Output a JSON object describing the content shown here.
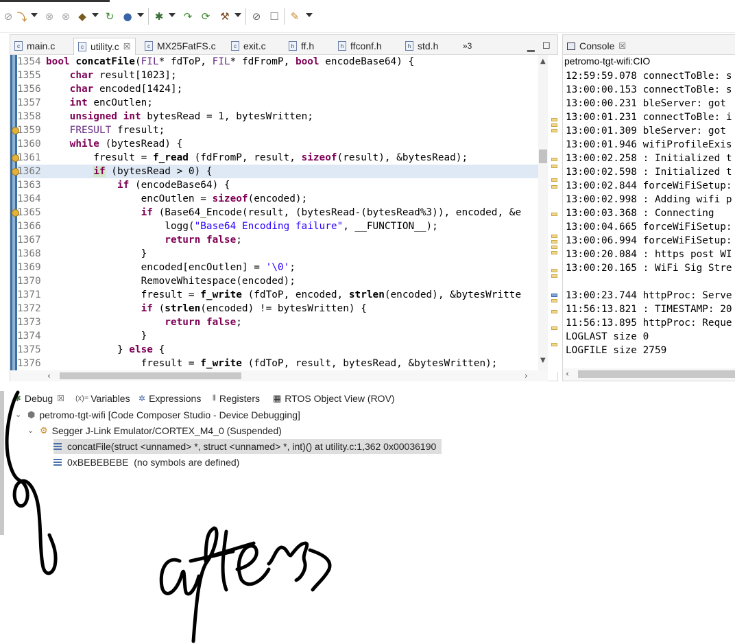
{
  "toolbar": {
    "buttons": [
      "resume-icon",
      "step-icon",
      "build-icon",
      "debug-icon",
      "run-icon",
      "external-tools-icon",
      "hammer-icon",
      "search-icon",
      "console-icon",
      "pin-icon"
    ]
  },
  "editor": {
    "tabs": [
      {
        "label": "main.c"
      },
      {
        "label": "utility.c",
        "active": true,
        "close": "☒"
      },
      {
        "label": "MX25FatFS.c"
      },
      {
        "label": "exit.c"
      },
      {
        "label": "ff.h"
      },
      {
        "label": "ffconf.h"
      },
      {
        "label": "std.h"
      }
    ],
    "overflow_label": "»3",
    "lines": [
      {
        "n": "1354",
        "segs": [
          [
            "kw",
            "bool"
          ],
          [
            "t",
            " "
          ],
          [
            "fn",
            "concatFile"
          ],
          [
            "t",
            "("
          ],
          [
            "ty",
            "FIL"
          ],
          [
            "t",
            "* fdToP, "
          ],
          [
            "ty",
            "FIL"
          ],
          [
            "t",
            "* fdFromP, "
          ],
          [
            "kw",
            "bool"
          ],
          [
            "t",
            " encodeBase64) {"
          ]
        ]
      },
      {
        "n": "1355",
        "segs": [
          [
            "t",
            "    "
          ],
          [
            "kw",
            "char"
          ],
          [
            "t",
            " result[1023];"
          ]
        ]
      },
      {
        "n": "1356",
        "segs": [
          [
            "t",
            "    "
          ],
          [
            "kw",
            "char"
          ],
          [
            "t",
            " encoded[1424];"
          ]
        ]
      },
      {
        "n": "1357",
        "segs": [
          [
            "t",
            "    "
          ],
          [
            "kw",
            "int"
          ],
          [
            "t",
            " encOutlen;"
          ]
        ]
      },
      {
        "n": "1358",
        "segs": [
          [
            "t",
            "    "
          ],
          [
            "kw",
            "unsigned"
          ],
          [
            "t",
            " "
          ],
          [
            "kw",
            "int"
          ],
          [
            "t",
            " bytesRead = 1, bytesWritten;"
          ]
        ]
      },
      {
        "n": "1359",
        "segs": [
          [
            "t",
            "    "
          ],
          [
            "ty",
            "FRESULT"
          ],
          [
            "t",
            " fresult;"
          ]
        ]
      },
      {
        "n": "1360",
        "segs": [
          [
            "t",
            "    "
          ],
          [
            "kw",
            "while"
          ],
          [
            "t",
            " (bytesRead) {"
          ]
        ]
      },
      {
        "n": "1361",
        "segs": [
          [
            "t",
            "        fresult = "
          ],
          [
            "fn",
            "f_read"
          ],
          [
            "t",
            " (fdFromP, result, "
          ],
          [
            "kw",
            "sizeof"
          ],
          [
            "t",
            "(result), &bytesRead);"
          ]
        ]
      },
      {
        "n": "1362",
        "segs": [
          [
            "t",
            "        "
          ],
          [
            "kw",
            "if"
          ],
          [
            "t",
            " (bytesRead > 0) {"
          ]
        ]
      },
      {
        "n": "1363",
        "segs": [
          [
            "t",
            "            "
          ],
          [
            "kw",
            "if"
          ],
          [
            "t",
            " (encodeBase64) {"
          ]
        ]
      },
      {
        "n": "1364",
        "segs": [
          [
            "t",
            "                encOutlen = "
          ],
          [
            "kw",
            "sizeof"
          ],
          [
            "t",
            "(encoded);"
          ]
        ]
      },
      {
        "n": "1365",
        "segs": [
          [
            "t",
            "                "
          ],
          [
            "kw",
            "if"
          ],
          [
            "t",
            " (Base64_Encode(result, (bytesRead-(bytesRead%3)), encoded, &e"
          ]
        ]
      },
      {
        "n": "1366",
        "segs": [
          [
            "t",
            "                    logg("
          ],
          [
            "str",
            "\"Base64 Encoding failure\""
          ],
          [
            "t",
            ", __FUNCTION__);"
          ]
        ]
      },
      {
        "n": "1367",
        "segs": [
          [
            "t",
            "                    "
          ],
          [
            "kw",
            "return"
          ],
          [
            "t",
            " "
          ],
          [
            "kw",
            "false"
          ],
          [
            "t",
            ";"
          ]
        ]
      },
      {
        "n": "1368",
        "segs": [
          [
            "t",
            "                }"
          ]
        ]
      },
      {
        "n": "1369",
        "segs": [
          [
            "t",
            "                encoded[encOutlen] = "
          ],
          [
            "str",
            "'\\0'"
          ],
          [
            "t",
            ";"
          ]
        ]
      },
      {
        "n": "1370",
        "segs": [
          [
            "t",
            "                RemoveWhitespace(encoded);"
          ]
        ]
      },
      {
        "n": "1371",
        "segs": [
          [
            "t",
            "                fresult = "
          ],
          [
            "fn",
            "f_write"
          ],
          [
            "t",
            " (fdToP, encoded, "
          ],
          [
            "fn",
            "strlen"
          ],
          [
            "t",
            "(encoded), &bytesWritte"
          ]
        ]
      },
      {
        "n": "1372",
        "segs": [
          [
            "t",
            "                "
          ],
          [
            "kw",
            "if"
          ],
          [
            "t",
            " ("
          ],
          [
            "fn",
            "strlen"
          ],
          [
            "t",
            "(encoded) != bytesWritten) {"
          ]
        ]
      },
      {
        "n": "1373",
        "segs": [
          [
            "t",
            "                    "
          ],
          [
            "kw",
            "return"
          ],
          [
            "t",
            " "
          ],
          [
            "kw",
            "false"
          ],
          [
            "t",
            ";"
          ]
        ]
      },
      {
        "n": "1374",
        "segs": [
          [
            "t",
            "                }"
          ]
        ]
      },
      {
        "n": "1375",
        "segs": [
          [
            "t",
            "            } "
          ],
          [
            "kw",
            "else"
          ],
          [
            "t",
            " {"
          ]
        ]
      },
      {
        "n": "1376",
        "segs": [
          [
            "t",
            "                fresult = "
          ],
          [
            "fn",
            "f_write"
          ],
          [
            "t",
            " (fdToP, result, bytesRead, &bytesWritten);"
          ]
        ]
      }
    ]
  },
  "console": {
    "title": "Console",
    "close": "☒",
    "process": "petromo-tgt-wifi:CIO",
    "lines": [
      "12:59:59.078 connectToBle: s",
      "13:00:00.153 connectToBle: s",
      "13:00:00.231 bleServer: got",
      "13:00:01.231 connectToBle: i",
      "13:00:01.309 bleServer: got",
      "13:00:01.946 wifiProfileExis",
      "13:00:02.258 : Initialized t",
      "13:00:02.598 : Initialized t",
      "13:00:02.844 forceWiFiSetup:",
      "13:00:02.998 : Adding wifi p",
      "13:00:03.368 : Connecting",
      "13:00:04.665 forceWiFiSetup:",
      "13:00:06.994 forceWiFiSetup:",
      "13:00:20.084 : https post WI",
      "13:00:20.165 : WiFi Sig Stre",
      "",
      "13:00:23.744 httpProc: Serve",
      "11:56:13.821 : TIMESTAMP: 20",
      "11:56:13.895 httpProc: Reque",
      "LOGLAST size 0",
      "LOGFILE size 2759"
    ]
  },
  "debug": {
    "tabs": [
      {
        "label": "Debug",
        "close": "☒"
      },
      {
        "label": "Variables",
        "prefix": "(x)="
      },
      {
        "label": "Expressions"
      },
      {
        "label": "Registers"
      },
      {
        "label": "RTOS Object View (ROV)"
      }
    ],
    "tree": {
      "project": "petromo-tgt-wifi [Code Composer Studio - Device Debugging]",
      "emulator": "Segger J-Link Emulator/CORTEX_M4_0 (Suspended)",
      "frames": [
        "concatFile(struct <unnamed> *, struct <unnamed> *, int)() at utility.c:1,362 0x00036190",
        "0xBEBEBEBE  (no symbols are defined)"
      ]
    }
  },
  "annotation": "after"
}
